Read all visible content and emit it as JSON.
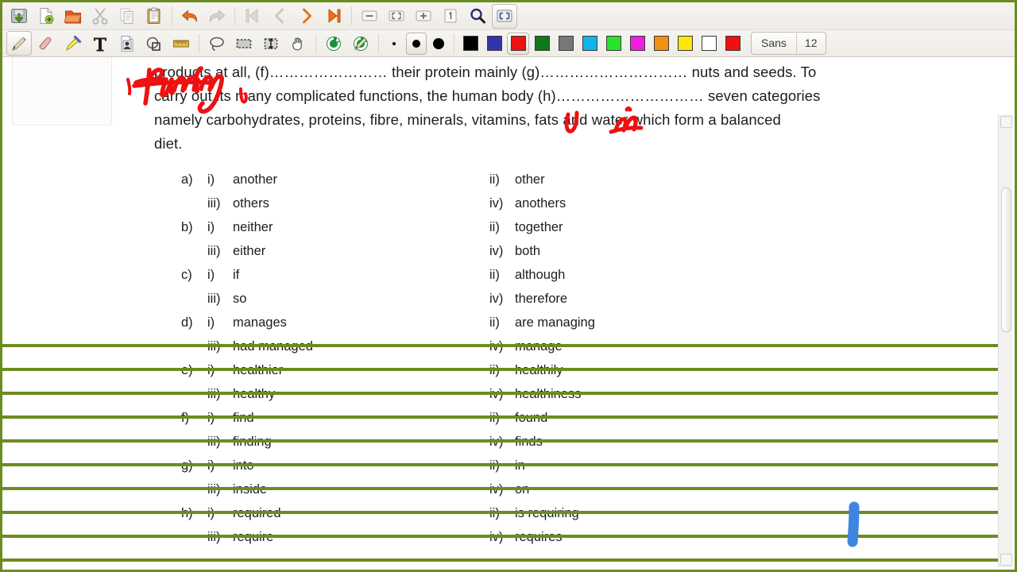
{
  "app": {
    "name": "Xournal",
    "accent_green": "#6b8c21",
    "ink_red": "#ee1111",
    "ink_blue": "#3d85e0"
  },
  "toolbar_main": {
    "buttons": [
      {
        "name": "save-button",
        "icon": "save-icon",
        "label": "Save"
      },
      {
        "name": "new-button",
        "icon": "new-document-icon",
        "label": "New"
      },
      {
        "name": "open-button",
        "icon": "open-folder-icon",
        "label": "Open"
      },
      {
        "name": "cut-button",
        "icon": "scissors-icon",
        "label": "Cut"
      },
      {
        "name": "copy-button",
        "icon": "copy-icon",
        "label": "Copy"
      },
      {
        "name": "paste-button",
        "icon": "clipboard-icon",
        "label": "Paste"
      },
      {
        "name": "undo-button",
        "icon": "undo-arrow-icon",
        "label": "Undo"
      },
      {
        "name": "redo-button",
        "icon": "redo-arrow-icon",
        "label": "Redo"
      },
      {
        "name": "first-page-button",
        "icon": "first-page-icon",
        "label": "First page"
      },
      {
        "name": "previous-page-button",
        "icon": "previous-page-icon",
        "label": "Previous page"
      },
      {
        "name": "next-page-button",
        "icon": "next-page-icon",
        "label": "Next page"
      },
      {
        "name": "last-page-button",
        "icon": "last-page-icon",
        "label": "Last page"
      },
      {
        "name": "zoom-out-button",
        "icon": "zoom-out-icon",
        "label": "Zoom out"
      },
      {
        "name": "zoom-fit-button",
        "icon": "zoom-fit-icon",
        "label": "Zoom to fit"
      },
      {
        "name": "zoom-in-button",
        "icon": "zoom-in-icon",
        "label": "Zoom in"
      },
      {
        "name": "zoom-100-button",
        "icon": "zoom-100-icon",
        "label": "Normal size"
      },
      {
        "name": "find-button",
        "icon": "magnifier-icon",
        "label": "Find"
      },
      {
        "name": "fullscreen-button",
        "icon": "fullscreen-icon",
        "label": "Full screen"
      }
    ]
  },
  "toolbar_pen": {
    "tools": [
      {
        "name": "pen-tool",
        "icon": "pencil-icon",
        "label": "Pen",
        "active": true
      },
      {
        "name": "eraser-tool",
        "icon": "eraser-icon",
        "label": "Eraser",
        "active": false
      },
      {
        "name": "highlighter-tool",
        "icon": "highlighter-icon",
        "label": "Highlighter",
        "active": false
      },
      {
        "name": "text-tool",
        "icon": "text-t-icon",
        "label": "Text",
        "active": false
      },
      {
        "name": "image-tool",
        "icon": "image-icon",
        "label": "Image",
        "active": false
      },
      {
        "name": "shape-tool",
        "icon": "shape-recognizer-icon",
        "label": "Shape recognizer",
        "active": false
      },
      {
        "name": "ruler-tool",
        "icon": "ruler-icon",
        "label": "Ruler",
        "active": false
      },
      {
        "name": "lasso-select-tool",
        "icon": "lasso-icon",
        "label": "Select region",
        "active": false
      },
      {
        "name": "rect-select-tool",
        "icon": "select-rectangle-icon",
        "label": "Select rectangle",
        "active": false
      },
      {
        "name": "vertical-space-tool",
        "icon": "vertical-space-icon",
        "label": "Vertical space",
        "active": false
      },
      {
        "name": "hand-tool",
        "icon": "hand-icon",
        "label": "Hand tool",
        "active": false
      },
      {
        "name": "default-pen-button",
        "icon": "default-pen-icon",
        "label": "Default pen",
        "active": false
      },
      {
        "name": "default-tool-button",
        "icon": "default-tool-icon",
        "label": "Default tool",
        "active": false
      }
    ],
    "thickness": [
      {
        "name": "thickness-fine",
        "size": 4,
        "selected": false
      },
      {
        "name": "thickness-medium",
        "size": 10,
        "selected": true
      },
      {
        "name": "thickness-thick",
        "size": 14,
        "selected": false
      }
    ],
    "colors": [
      {
        "name": "color-black",
        "hex": "#000000",
        "selected": false
      },
      {
        "name": "color-blue",
        "hex": "#3333aa",
        "selected": false
      },
      {
        "name": "color-red",
        "hex": "#ee1111",
        "selected": true
      },
      {
        "name": "color-green",
        "hex": "#11771b",
        "selected": false
      },
      {
        "name": "color-gray",
        "hex": "#777777",
        "selected": false
      },
      {
        "name": "color-cyan",
        "hex": "#12b5ea",
        "selected": false
      },
      {
        "name": "color-lime",
        "hex": "#2ae22a",
        "selected": false
      },
      {
        "name": "color-magenta",
        "hex": "#ee1ee1",
        "selected": false
      },
      {
        "name": "color-orange",
        "hex": "#f29010",
        "selected": false
      },
      {
        "name": "color-yellow",
        "hex": "#fbe70c",
        "selected": false
      },
      {
        "name": "color-white",
        "hex": "#ffffff",
        "selected": false
      },
      {
        "name": "color-custom-red",
        "hex": "#ee1111",
        "selected": false
      }
    ],
    "font": {
      "family_label": "Sans",
      "size_label": "12"
    }
  },
  "document": {
    "paragraph_line_1": "products at all, (f)…………………… their protein mainly (g)………………………… nuts and seeds. To",
    "paragraph_line_2": "carry out its many complicated functions, the human body (h)………………………… seven categories",
    "paragraph_line_3": "namely carbohydrates, proteins, fibre, minerals, vitamins, fats and water which form a balanced",
    "paragraph_line_4": "diet.",
    "options": [
      {
        "letter": "a)",
        "i": "i)",
        "opt1": "another",
        "ii": "ii)",
        "opt2": "other"
      },
      {
        "letter": "",
        "i": "iii)",
        "opt1": "others",
        "ii": "iv)",
        "opt2": "anothers"
      },
      {
        "letter": "b)",
        "i": "i)",
        "opt1": "neither",
        "ii": "ii)",
        "opt2": "together"
      },
      {
        "letter": "",
        "i": "iii)",
        "opt1": "either",
        "ii": "iv)",
        "opt2": "both"
      },
      {
        "letter": "c)",
        "i": "i)",
        "opt1": "if",
        "ii": "ii)",
        "opt2": "although"
      },
      {
        "letter": "",
        "i": "iii)",
        "opt1": "so",
        "ii": "iv)",
        "opt2": "therefore"
      },
      {
        "letter": "d)",
        "i": "i)",
        "opt1": "manages",
        "ii": "ii)",
        "opt2": "are managing"
      },
      {
        "letter": "",
        "i": "iii)",
        "opt1": "had managed",
        "ii": "iv)",
        "opt2": "manage"
      },
      {
        "letter": "e)",
        "i": "i)",
        "opt1": "healthier",
        "ii": "ii)",
        "opt2": "healthily"
      },
      {
        "letter": "",
        "i": "iii)",
        "opt1": "healthy",
        "ii": "iv)",
        "opt2": "healthiness"
      },
      {
        "letter": "f)",
        "i": "i)",
        "opt1": "find",
        "ii": "ii)",
        "opt2": "found"
      },
      {
        "letter": "",
        "i": "iii)",
        "opt1": "finding",
        "ii": "iv)",
        "opt2": "finds"
      },
      {
        "letter": "g)",
        "i": "i)",
        "opt1": "into",
        "ii": "ii)",
        "opt2": "in"
      },
      {
        "letter": "",
        "i": "iii)",
        "opt1": "inside",
        "ii": "iv)",
        "opt2": "on"
      },
      {
        "letter": "h)",
        "i": "i)",
        "opt1": "required",
        "ii": "ii)",
        "opt2": "is requiring"
      },
      {
        "letter": "",
        "i": "iii)",
        "opt1": "require",
        "ii": "iv)",
        "opt2": "requires"
      }
    ]
  },
  "annotations": {
    "handwriting": [
      {
        "name": "ink-finding",
        "text": "finding",
        "color": "#ee1111"
      },
      {
        "name": "ink-u-mark",
        "text": "U",
        "color": "#ee1111"
      },
      {
        "name": "ink-in",
        "text": "in",
        "color": "#ee1111"
      },
      {
        "name": "ink-blue-stroke",
        "text": "",
        "color": "#3d85e0"
      }
    ],
    "ruled_lines_color": "#6b8c21",
    "ruled_lines_count": 10
  }
}
